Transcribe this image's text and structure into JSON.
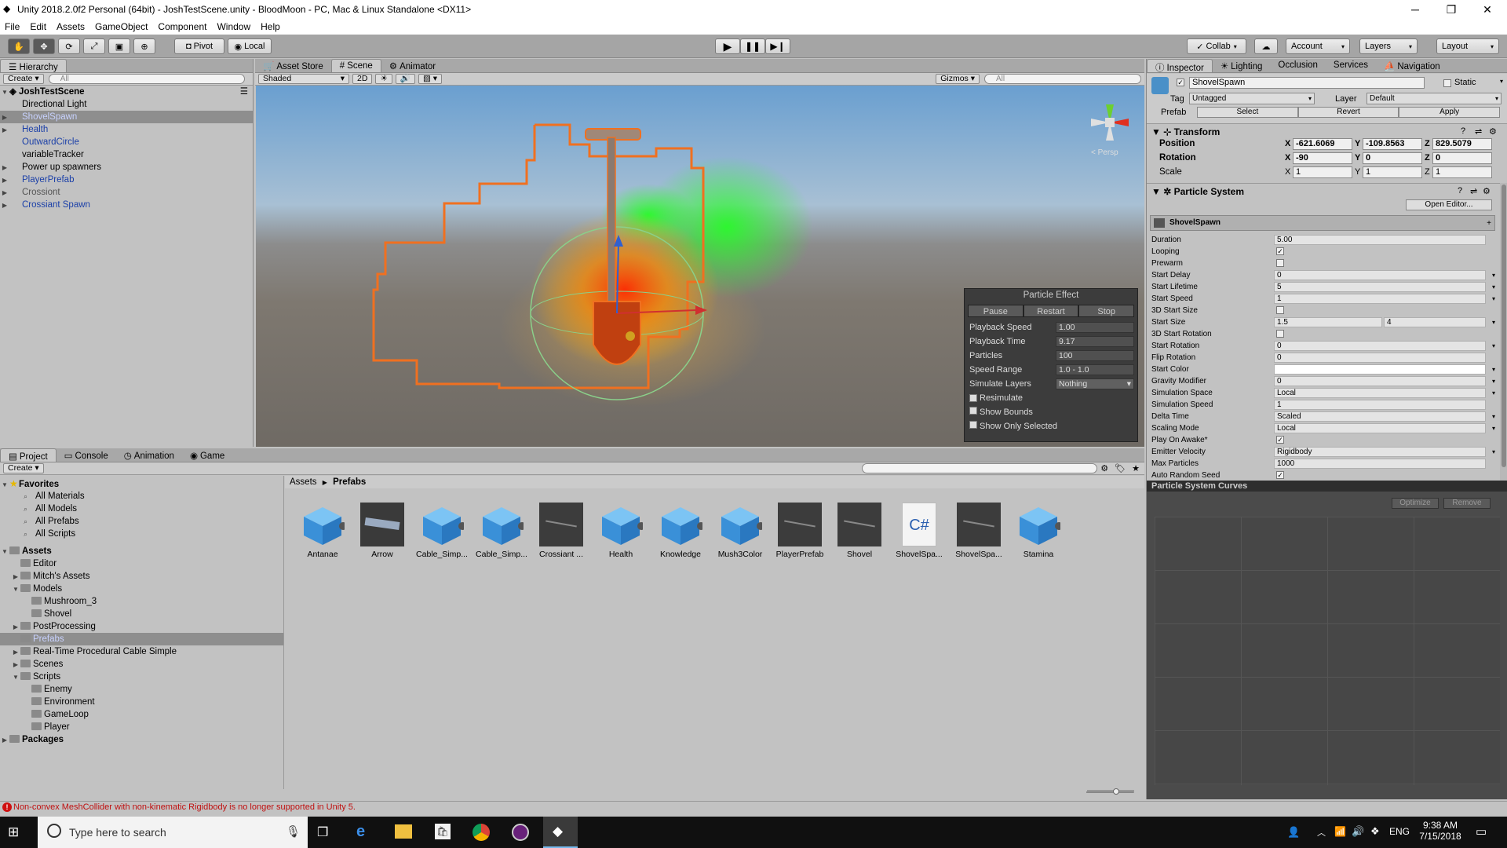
{
  "window": {
    "title": "Unity 2018.2.0f2 Personal (64bit) - JoshTestScene.unity - BloodMoon - PC, Mac & Linux Standalone <DX11>"
  },
  "menu": [
    "File",
    "Edit",
    "Assets",
    "GameObject",
    "Component",
    "Window",
    "Help"
  ],
  "toolbar": {
    "pivot": "Pivot",
    "local": "Local",
    "collab": "Collab",
    "account": "Account",
    "layers": "Layers",
    "layout": "Layout"
  },
  "hierarchy": {
    "tab": "Hierarchy",
    "create": "Create",
    "search_placeholder": "All",
    "scene": "JoshTestScene",
    "items": [
      {
        "label": "Directional Light",
        "color": "black",
        "arrow": false
      },
      {
        "label": "ShovelSpawn",
        "color": "selected",
        "arrow": true
      },
      {
        "label": "Health",
        "color": "blue",
        "arrow": true
      },
      {
        "label": "OutwardCircle",
        "color": "blue",
        "arrow": false
      },
      {
        "label": "variableTracker",
        "color": "black",
        "arrow": false
      },
      {
        "label": "Power up spawners",
        "color": "black",
        "arrow": true
      },
      {
        "label": "PlayerPrefab",
        "color": "blue",
        "arrow": true
      },
      {
        "label": "Crossiont",
        "color": "grey",
        "arrow": true
      },
      {
        "label": "Crossiant Spawn",
        "color": "blue",
        "arrow": true
      }
    ]
  },
  "scene_tabs": [
    "Asset Store",
    "Scene",
    "Animator"
  ],
  "scene_toolbar": {
    "shaded": "Shaded",
    "twod": "2D",
    "gizmos": "Gizmos",
    "search_placeholder": "All",
    "persp": "< Persp"
  },
  "particle_effect": {
    "title": "Particle Effect",
    "pause": "Pause",
    "restart": "Restart",
    "stop": "Stop",
    "rows": [
      {
        "label": "Playback Speed",
        "value": "1.00"
      },
      {
        "label": "Playback Time",
        "value": "9.17"
      },
      {
        "label": "Particles",
        "value": "100"
      },
      {
        "label": "Speed Range",
        "value": "1.0 - 1.0"
      },
      {
        "label": "Simulate Layers",
        "value": "Nothing"
      }
    ],
    "checks": [
      {
        "label": "Resimulate",
        "checked": true
      },
      {
        "label": "Show Bounds",
        "checked": false
      },
      {
        "label": "Show Only Selected",
        "checked": false
      }
    ]
  },
  "inspector": {
    "tabs": [
      "Inspector",
      "Lighting",
      "Occlusion",
      "Services",
      "Navigation"
    ],
    "object_name": "ShovelSpawn",
    "static": "Static",
    "tag_label": "Tag",
    "tag_value": "Untagged",
    "layer_label": "Layer",
    "layer_value": "Default",
    "prefab_label": "Prefab",
    "prefab_select": "Select",
    "prefab_revert": "Revert",
    "prefab_apply": "Apply",
    "transform": {
      "title": "Transform",
      "position_label": "Position",
      "rotation_label": "Rotation",
      "scale_label": "Scale",
      "position": [
        "-621.6069",
        "-109.8563",
        "829.5079"
      ],
      "rotation": [
        "-90",
        "0",
        "0"
      ],
      "scale": [
        "1",
        "1",
        "1"
      ]
    },
    "particle_system": {
      "title": "Particle System",
      "open_editor": "Open Editor...",
      "module": "ShovelSpawn",
      "rows": [
        {
          "k": "Duration",
          "v": "5.00"
        },
        {
          "k": "Looping",
          "v": "check"
        },
        {
          "k": "Prewarm",
          "v": "box"
        },
        {
          "k": "Start Delay",
          "v": "0"
        },
        {
          "k": "Start Lifetime",
          "v": "5"
        },
        {
          "k": "Start Speed",
          "v": "1"
        },
        {
          "k": "3D Start Size",
          "v": "box"
        },
        {
          "k": "Start Size",
          "v": "1.5",
          "v2": "4"
        },
        {
          "k": "3D Start Rotation",
          "v": "box"
        },
        {
          "k": "Start Rotation",
          "v": "0"
        },
        {
          "k": "Flip Rotation",
          "v": "0"
        },
        {
          "k": "Start Color",
          "v": "color"
        },
        {
          "k": "Gravity Modifier",
          "v": "0"
        },
        {
          "k": "Simulation Space",
          "v": "Local"
        },
        {
          "k": "Simulation Speed",
          "v": "1"
        },
        {
          "k": "Delta Time",
          "v": "Scaled"
        },
        {
          "k": "Scaling Mode",
          "v": "Local"
        },
        {
          "k": "Play On Awake*",
          "v": "check"
        },
        {
          "k": "Emitter Velocity",
          "v": "Rigidbody"
        },
        {
          "k": "Max Particles",
          "v": "1000"
        },
        {
          "k": "Auto Random Seed",
          "v": "check"
        }
      ]
    },
    "curves": {
      "title": "Particle System Curves",
      "optimize": "Optimize",
      "remove": "Remove"
    }
  },
  "project": {
    "tabs": [
      "Project",
      "Console",
      "Animation",
      "Game"
    ],
    "create": "Create",
    "favorites_title": "Favorites",
    "favorites": [
      "All Materials",
      "All Models",
      "All Prefabs",
      "All Scripts"
    ],
    "assets_title": "Assets",
    "tree": [
      {
        "label": "Editor",
        "indent": 1,
        "arrow": ""
      },
      {
        "label": "Mitch's Assets",
        "indent": 1,
        "arrow": "▶"
      },
      {
        "label": "Models",
        "indent": 1,
        "arrow": "▼"
      },
      {
        "label": "Mushroom_3",
        "indent": 2,
        "arrow": ""
      },
      {
        "label": "Shovel",
        "indent": 2,
        "arrow": ""
      },
      {
        "label": "PostProcessing",
        "indent": 1,
        "arrow": "▶"
      },
      {
        "label": "Prefabs",
        "indent": 1,
        "arrow": "",
        "selected": true
      },
      {
        "label": "Real-Time Procedural Cable Simple",
        "indent": 1,
        "arrow": "▶"
      },
      {
        "label": "Scenes",
        "indent": 1,
        "arrow": "▶"
      },
      {
        "label": "Scripts",
        "indent": 1,
        "arrow": "▼"
      },
      {
        "label": "Enemy",
        "indent": 2,
        "arrow": ""
      },
      {
        "label": "Environment",
        "indent": 2,
        "arrow": ""
      },
      {
        "label": "GameLoop",
        "indent": 2,
        "arrow": ""
      },
      {
        "label": "Player",
        "indent": 2,
        "arrow": ""
      }
    ],
    "packages_title": "Packages",
    "breadcrumb_root": "Assets",
    "breadcrumb_current": "Prefabs",
    "assets": [
      {
        "label": "Antanae",
        "kind": "cube"
      },
      {
        "label": "Arrow",
        "kind": "arrow"
      },
      {
        "label": "Cable_Simp...",
        "kind": "cube"
      },
      {
        "label": "Cable_Simp...",
        "kind": "cube"
      },
      {
        "label": "Crossiant ...",
        "kind": "dark"
      },
      {
        "label": "Health",
        "kind": "cube"
      },
      {
        "label": "Knowledge",
        "kind": "cube"
      },
      {
        "label": "Mush3Color",
        "kind": "cube"
      },
      {
        "label": "PlayerPrefab",
        "kind": "dark"
      },
      {
        "label": "Shovel",
        "kind": "dark"
      },
      {
        "label": "ShovelSpa...",
        "kind": "script"
      },
      {
        "label": "ShovelSpa...",
        "kind": "dark"
      },
      {
        "label": "Stamina",
        "kind": "cube"
      }
    ],
    "script_glyph": "C#"
  },
  "status": {
    "error": "Non-convex MeshCollider with non-kinematic Rigidbody is no longer supported in Unity 5."
  },
  "taskbar": {
    "search_placeholder": "Type here to search",
    "lang": "ENG",
    "time": "9:38 AM",
    "date": "7/15/2018"
  }
}
